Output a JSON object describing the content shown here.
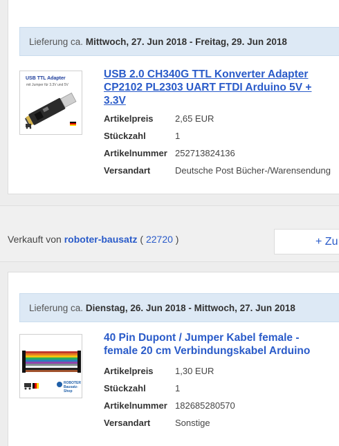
{
  "order1": {
    "delivery_prefix": "Lieferung ca.",
    "delivery_dates": "Mittwoch, 27. Jun 2018 - Freitag, 29. Jun 2018",
    "title": "USB 2.0 CH340G TTL Konverter Adapter CP2102 PL2303 UART FTDI Arduino 5V + 3.3V",
    "image_caption": "USB TTL Adapter",
    "image_subcaption": "mit Jumper für 3.3V und 5V",
    "details": [
      {
        "label": "Artikelpreis",
        "value": "2,65 EUR"
      },
      {
        "label": "Stückzahl",
        "value": "1"
      },
      {
        "label": "Artikelnummer",
        "value": "252713824136"
      },
      {
        "label": "Versandart",
        "value": "Deutsche Post Bücher-/Warensendung"
      }
    ]
  },
  "seller": {
    "prefix": "Verkauft von",
    "name": "roboter-bausatz",
    "open_paren": "(",
    "rating": "22720",
    "close_paren": ")",
    "action_label": "+ Zu"
  },
  "order2": {
    "delivery_prefix": "Lieferung ca.",
    "delivery_dates": "Dienstag, 26. Jun 2018 - Mittwoch, 27. Jun 2018",
    "title": "40 Pin Dupont / Jumper Kabel female - female 20 cm Verbindungskabel Arduino",
    "image_caption": "ROBOTER Bausatz-Shop",
    "details": [
      {
        "label": "Artikelpreis",
        "value": "1,30 EUR"
      },
      {
        "label": "Stückzahl",
        "value": "1"
      },
      {
        "label": "Artikelnummer",
        "value": "182685280570"
      },
      {
        "label": "Versandart",
        "value": "Sonstige"
      }
    ]
  },
  "colors": {
    "link": "#2a5bc9",
    "delivery_bg": "#dde9f5",
    "page_bg": "#ededed"
  }
}
